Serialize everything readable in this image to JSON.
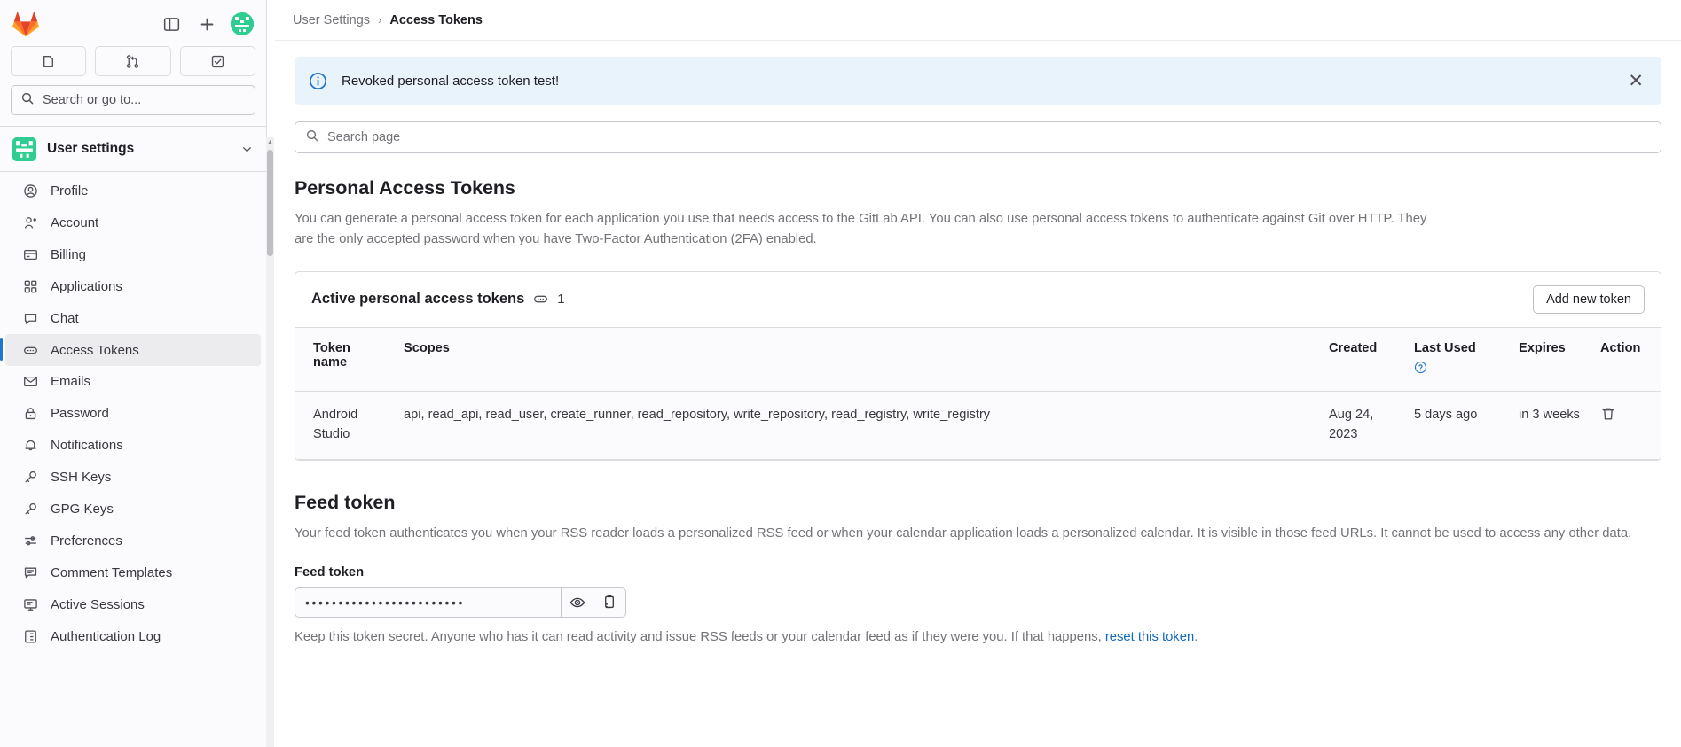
{
  "sidebar": {
    "logo_icon": "gitlab-logo-icon",
    "toggle_icon": "sidebar-toggle-icon",
    "new_icon": "plus-icon",
    "avatar_icon": "user-avatar",
    "quick_links": [
      {
        "name": "issues",
        "icon": "issue-icon"
      },
      {
        "name": "merge-requests",
        "icon": "merge-request-icon"
      },
      {
        "name": "todos",
        "icon": "todo-check-icon"
      }
    ],
    "search_label": "Search or go to...",
    "search_icon": "search-icon",
    "context": {
      "label": "User settings",
      "avatar_icon": "user-avatar",
      "chevron_icon": "chevron-down-icon"
    },
    "items": [
      {
        "label": "Profile",
        "icon": "profile-icon",
        "active": false
      },
      {
        "label": "Account",
        "icon": "account-icon",
        "active": false
      },
      {
        "label": "Billing",
        "icon": "billing-card-icon",
        "active": false
      },
      {
        "label": "Applications",
        "icon": "applications-grid-icon",
        "active": false
      },
      {
        "label": "Chat",
        "icon": "chat-bubble-icon",
        "active": false
      },
      {
        "label": "Access Tokens",
        "icon": "token-icon",
        "active": true
      },
      {
        "label": "Emails",
        "icon": "envelope-icon",
        "active": false
      },
      {
        "label": "Password",
        "icon": "lock-icon",
        "active": false
      },
      {
        "label": "Notifications",
        "icon": "bell-icon",
        "active": false
      },
      {
        "label": "SSH Keys",
        "icon": "key-icon",
        "active": false
      },
      {
        "label": "GPG Keys",
        "icon": "key-icon",
        "active": false
      },
      {
        "label": "Preferences",
        "icon": "sliders-icon",
        "active": false
      },
      {
        "label": "Comment Templates",
        "icon": "comment-lines-icon",
        "active": false
      },
      {
        "label": "Active Sessions",
        "icon": "monitor-icon",
        "active": false
      },
      {
        "label": "Authentication Log",
        "icon": "log-list-icon",
        "active": false
      }
    ]
  },
  "breadcrumb": {
    "parent": "User Settings",
    "separator": "›",
    "current": "Access Tokens"
  },
  "alert": {
    "icon": "info-circle-icon",
    "message": "Revoked personal access token test!",
    "close_icon": "close-icon",
    "close_glyph": "✕",
    "bg_color": "#e9f3fc",
    "icon_color": "#1f75cb"
  },
  "page_search": {
    "placeholder": "Search page",
    "icon": "search-icon",
    "value": ""
  },
  "pat_section": {
    "title": "Personal Access Tokens",
    "description": "You can generate a personal access token for each application you use that needs access to the GitLab API. You can also use personal access tokens to authenticate against Git over HTTP. They are the only accepted password when you have Two-Factor Authentication (2FA) enabled.",
    "card": {
      "title": "Active personal access tokens",
      "count_icon": "token-icon",
      "count": "1",
      "add_button": "Add new token"
    },
    "columns": [
      "Token name",
      "Scopes",
      "Created",
      "Last Used",
      "Expires",
      "Action"
    ],
    "last_used_help_icon": "question-circle-icon",
    "rows": [
      {
        "name": "Android Studio",
        "scopes": "api, read_api, read_user, create_runner, read_repository, write_repository, read_registry, write_registry",
        "created": "Aug 24, 2023",
        "last_used": "5 days ago",
        "expires": "in 3 weeks",
        "action_icon": "trash-icon"
      }
    ]
  },
  "feed_section": {
    "title": "Feed token",
    "description": "Your feed token authenticates you when your RSS reader loads a personalized RSS feed or when your calendar application loads a personalized calendar. It is visible in those feed URLs. It cannot be used to access any other data.",
    "label": "Feed token",
    "masked_value": "••••••••••••••••••••••••",
    "reveal_icon": "eye-icon",
    "copy_icon": "clipboard-copy-icon",
    "note_before": "Keep this token secret. Anyone who has it can read activity and issue RSS feeds or your calendar feed as if they were you. If that happens, ",
    "note_link": "reset this token",
    "note_after": ".",
    "link_color": "#1068bf"
  }
}
